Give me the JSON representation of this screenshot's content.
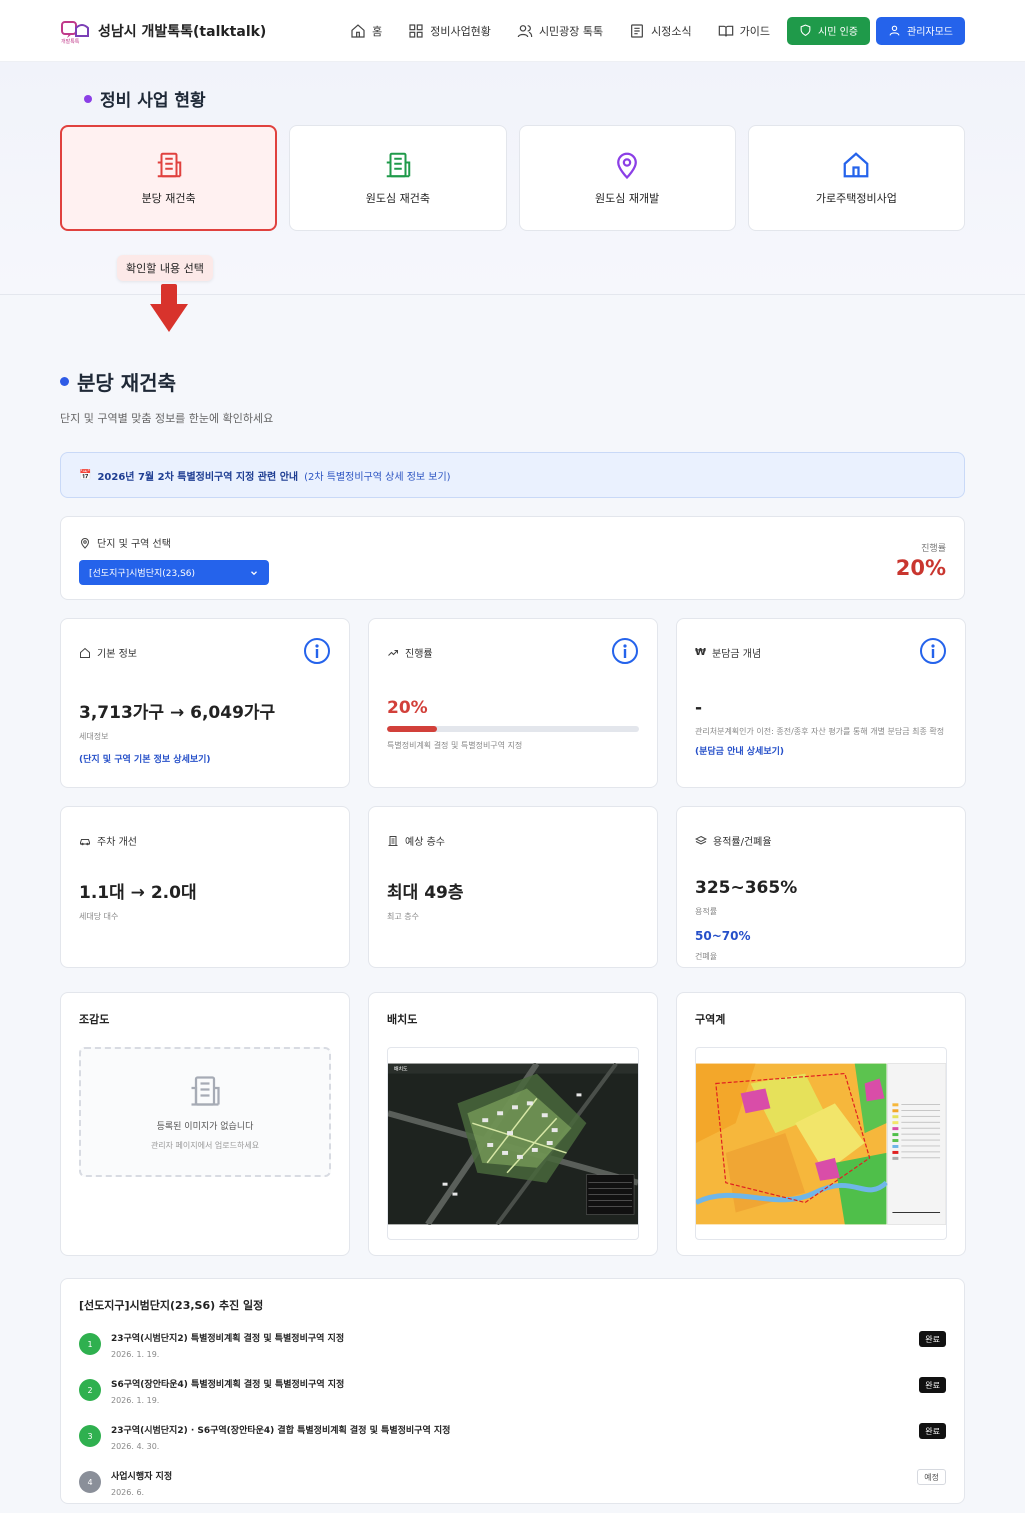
{
  "header": {
    "brand_title": "성남시 개발톡톡(talktalk)",
    "nav": [
      {
        "label": "홈",
        "icon": "home-icon"
      },
      {
        "label": "정비사업현황",
        "icon": "grid-icon"
      },
      {
        "label": "시민광장 톡톡",
        "icon": "users-icon"
      },
      {
        "label": "시정소식",
        "icon": "newspaper-icon"
      },
      {
        "label": "가이드",
        "icon": "book-icon"
      }
    ],
    "citizen_button": "시민 인증",
    "admin_button": "관리자모드"
  },
  "band": {
    "title": "정비 사업 현황",
    "categories": [
      {
        "label": "분당 재건축",
        "icon": "building-icon",
        "color": "#e0413e",
        "active": true
      },
      {
        "label": "원도심 재건축",
        "icon": "building-icon",
        "color": "#1f9a4a",
        "active": false
      },
      {
        "label": "원도심 재개발",
        "icon": "map-pin-icon",
        "color": "#8b3fe6",
        "active": false
      },
      {
        "label": "가로주택정비사업",
        "icon": "home-icon",
        "color": "#2563eb",
        "active": false
      }
    ],
    "hint": "확인할 내용 선택"
  },
  "main": {
    "title": "분당 재건축",
    "subtitle": "단지 및 구역별 맞춤 정보를 한눈에 확인하세요",
    "notice": {
      "emoji": "📅",
      "bold": "2026년 7월 2차 특별정비구역 지정 관련 안내",
      "rest": "(2차 특별정비구역 상세 정보 보기)"
    },
    "selector": {
      "label": "단지 및 구역 선택",
      "value": "[선도지구]시범단지(23,S6)",
      "progress_label": "진행률",
      "progress_value": "20%"
    },
    "basic": {
      "title": "기본 정보",
      "value": "3,713가구 → 6,049가구",
      "caption": "세대정보",
      "link": "(단지 및 구역 기본 정보 상세보기)"
    },
    "progress": {
      "title": "진행률",
      "value": "20%",
      "fraction": 0.2,
      "caption": "특별정비계획 결정 및 특별정비구역 지정"
    },
    "contribution": {
      "title": "분담금 개념",
      "value": "-",
      "caption": "관리처분계획인가 이전: 종전/종후 자산 평가를 통해 개별 분담금 최종 확정",
      "link": "(분담금 안내 상세보기)"
    },
    "parking": {
      "title": "주차 개선",
      "value": "1.1대 → 2.0대",
      "caption": "세대당 대수"
    },
    "floors": {
      "title": "예상 층수",
      "value": "최대 49층",
      "caption": "최고 층수"
    },
    "ratio": {
      "title": "용적률/건폐율",
      "far_value": "325~365%",
      "far_caption": "용적률",
      "bcr_value": "50~70%",
      "bcr_caption": "건폐율"
    },
    "images": {
      "birdseye_title": "조감도",
      "birdseye_empty": "등록된 이미지가 없습니다",
      "birdseye_sub": "관리자 페이지에서 업로드하세요",
      "layout_title": "배치도",
      "layout_label": "배치도",
      "zone_title": "구역계"
    },
    "schedule": {
      "title": "[선도지구]시범단지(23,S6) 추진 일정",
      "steps": [
        {
          "num": "1",
          "name": "23구역(시범단지2) 특별정비계획 결정 및 특별정비구역 지정",
          "date": "2026. 1. 19.",
          "status": "완료",
          "done": true
        },
        {
          "num": "2",
          "name": "S6구역(장안타운4) 특별정비계획 결정 및 특별정비구역 지정",
          "date": "2026. 1. 19.",
          "status": "완료",
          "done": true
        },
        {
          "num": "3",
          "name": "23구역(시범단지2) · S6구역(장안타운4) 결합 특별정비계획 결정 및 특별정비구역 지정",
          "date": "2026. 4. 30.",
          "status": "완료",
          "done": true
        },
        {
          "num": "4",
          "name": "사업시행자 지정",
          "date": "2026. 6.",
          "status": "예정",
          "done": false
        }
      ]
    }
  }
}
